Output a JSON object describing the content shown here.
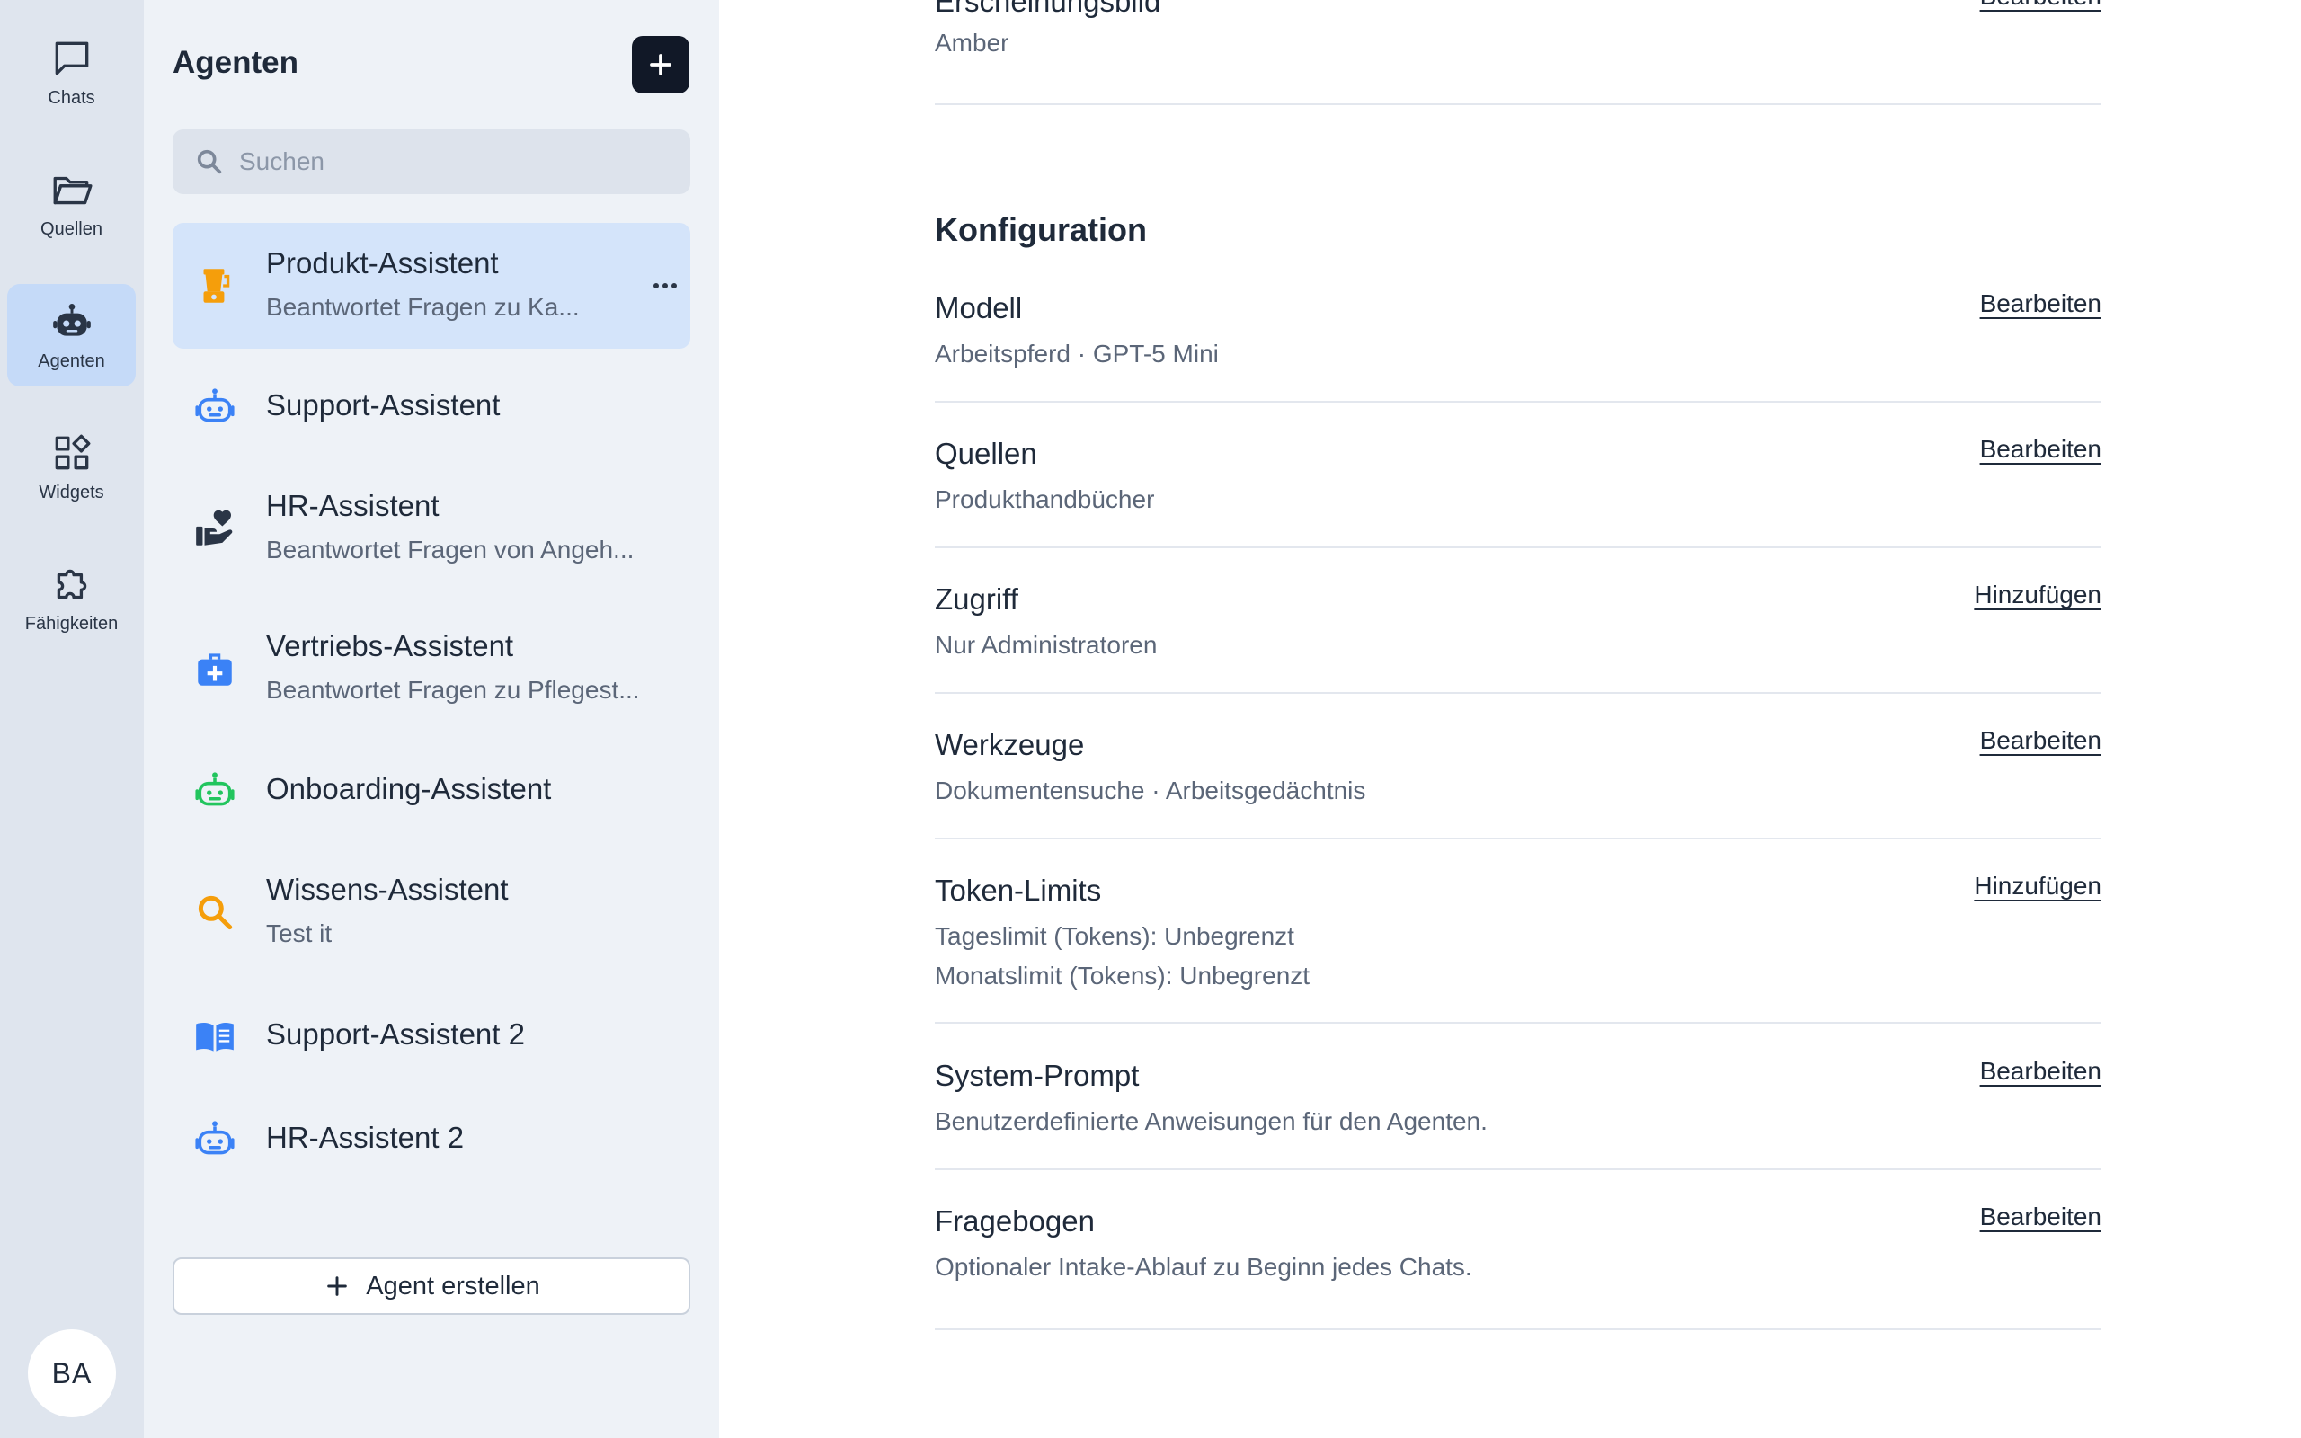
{
  "rail": {
    "items": [
      {
        "label": "Chats",
        "icon": "chat-icon",
        "active": false
      },
      {
        "label": "Quellen",
        "icon": "folder-icon",
        "active": false
      },
      {
        "label": "Agenten",
        "icon": "robot-icon",
        "active": true
      },
      {
        "label": "Widgets",
        "icon": "widgets-icon",
        "active": false
      },
      {
        "label": "Fähigkeiten",
        "icon": "puzzle-icon",
        "active": false
      }
    ],
    "avatar_initials": "BA"
  },
  "panel": {
    "title": "Agenten",
    "search_placeholder": "Suchen",
    "agents": [
      {
        "name": "Produkt-Assistent",
        "description": "Beantwortet Fragen zu Ka...",
        "icon": "blender-icon",
        "color": "#f59e0b",
        "active": true
      },
      {
        "name": "Support-Assistent",
        "description": "",
        "icon": "robot-icon",
        "color": "#3b82f6",
        "active": false
      },
      {
        "name": "HR-Assistent",
        "description": "Beantwortet Fragen von Angeh...",
        "icon": "hand-heart-icon",
        "color": "#2a3546",
        "active": false
      },
      {
        "name": "Vertriebs-Assistent",
        "description": "Beantwortet Fragen zu Pflegest...",
        "icon": "medical-bag-icon",
        "color": "#3b82f6",
        "active": false
      },
      {
        "name": "Onboarding-Assistent",
        "description": "",
        "icon": "robot-icon",
        "color": "#22c55e",
        "active": false
      },
      {
        "name": "Wissens-Assistent",
        "description": "Test it",
        "icon": "search-icon",
        "color": "#f59e0b",
        "active": false
      },
      {
        "name": "Support-Assistent 2",
        "description": "",
        "icon": "book-icon",
        "color": "#3b82f6",
        "active": false
      },
      {
        "name": "HR-Assistent 2",
        "description": "",
        "icon": "robot-icon",
        "color": "#3b82f6",
        "active": false
      }
    ],
    "create_label": "Agent erstellen"
  },
  "main": {
    "top_partial": {
      "label": "Erscheinungsbild",
      "value": "Amber",
      "action": "Bearbeiten"
    },
    "section_title": "Konfiguration",
    "rows": [
      {
        "label": "Modell",
        "values": [
          "Arbeitspferd · GPT-5 Mini"
        ],
        "action": "Bearbeiten"
      },
      {
        "label": "Quellen",
        "values": [
          "Produkthandbücher"
        ],
        "action": "Bearbeiten"
      },
      {
        "label": "Zugriff",
        "values": [
          "Nur Administratoren"
        ],
        "action": "Hinzufügen"
      },
      {
        "label": "Werkzeuge",
        "values": [
          "Dokumentensuche · Arbeitsgedächtnis"
        ],
        "action": "Bearbeiten"
      },
      {
        "label": "Token-Limits",
        "values": [
          "Tageslimit (Tokens): Unbegrenzt",
          "Monatslimit (Tokens): Unbegrenzt"
        ],
        "action": "Hinzufügen"
      },
      {
        "label": "System-Prompt",
        "values": [
          "Benutzerdefinierte Anweisungen für den Agenten."
        ],
        "action": "Bearbeiten"
      },
      {
        "label": "Fragebogen",
        "values": [
          "Optionaler Intake-Ablauf zu Beginn jedes Chats."
        ],
        "action": "Bearbeiten"
      }
    ]
  }
}
